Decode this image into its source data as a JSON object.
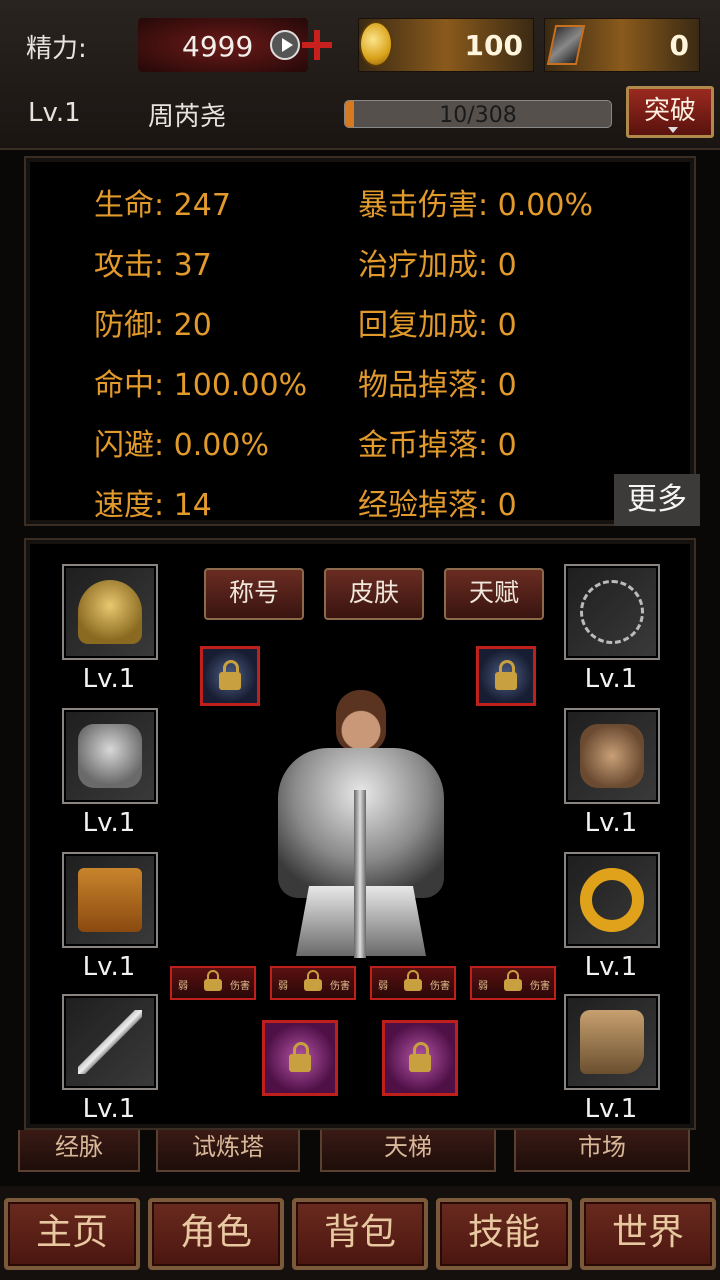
{
  "header": {
    "energy_label": "精力:",
    "energy_value": "4999",
    "gold": "100",
    "gems": "0",
    "level": "Lv.1",
    "player_name": "周芮尧",
    "exp_text": "10/308",
    "exp_progress": 0.032,
    "breakthrough_label": "突破"
  },
  "stats": {
    "left": [
      "生命: 247",
      "攻击: 37",
      "防御: 20",
      "命中: 100.00%",
      "闪避: 0.00%",
      "速度: 14"
    ],
    "right": [
      "暴击伤害: 0.00%",
      "治疗加成: 0",
      "回复加成: 0",
      "物品掉落: 0",
      "金币掉落: 0",
      "经验掉落: 0"
    ],
    "more_label": "更多"
  },
  "equipment": {
    "tabs": [
      "称号",
      "皮肤",
      "天赋"
    ],
    "slots": [
      {
        "icon": "helmet-icon",
        "level": "Lv.1"
      },
      {
        "icon": "chest-armor-icon",
        "level": "Lv.1"
      },
      {
        "icon": "pants-icon",
        "level": "Lv.1"
      },
      {
        "icon": "sword-icon",
        "level": "Lv.1"
      },
      {
        "icon": "necklace-icon",
        "level": "Lv.1"
      },
      {
        "icon": "gauntlet-icon",
        "level": "Lv.1"
      },
      {
        "icon": "ring-icon",
        "level": "Lv.1"
      },
      {
        "icon": "boot-icon",
        "level": "Lv.1"
      }
    ],
    "seal_text_left": "弱",
    "seal_text_right": "伤害"
  },
  "sub_nav": [
    "经脉",
    "试炼塔",
    "天梯",
    "市场"
  ],
  "main_nav": [
    "主页",
    "角色",
    "背包",
    "技能",
    "世界"
  ],
  "colors": {
    "stat_text": "#e29a2c",
    "accent_red": "#c0201c",
    "exp_fill": "#d77a1f"
  }
}
